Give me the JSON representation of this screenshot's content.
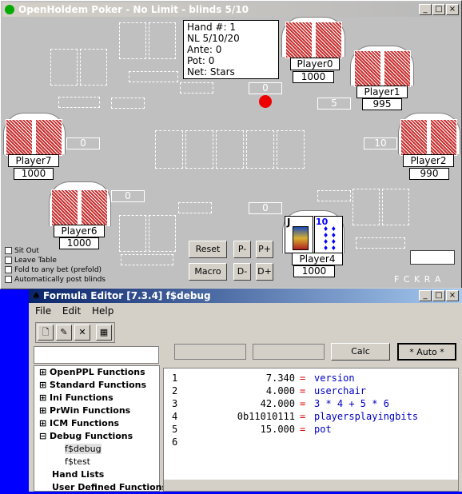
{
  "poker": {
    "title": "OpenHoldem Poker - No Limit - blinds 5/10",
    "info": [
      "Hand #: 1",
      "NL 5/10/20",
      "Ante: 0",
      "Pot: 0",
      "Net: Stars"
    ],
    "players": [
      {
        "name": "Player0",
        "balance": "1000"
      },
      {
        "name": "Player1",
        "balance": "995",
        "bet": "5"
      },
      {
        "name": "Player2",
        "balance": "990",
        "bet": "10"
      },
      {
        "name": "Player4",
        "balance": "1000",
        "bet": "0"
      },
      {
        "name": "Player6",
        "balance": "1000",
        "bet": "0"
      },
      {
        "name": "Player7",
        "balance": "1000",
        "bet": "0"
      }
    ],
    "p0bet": "0",
    "buttons": {
      "reset": "Reset",
      "pminus": "P-",
      "pplus": "P+",
      "macro": "Macro",
      "dminus": "D-",
      "dplus": "D+"
    },
    "checks": [
      "Sit Out",
      "Leave Table",
      "Fold to any bet (prefold)",
      "Automatically post blinds"
    ],
    "flags": "F C K R A",
    "hero_cards": [
      "J",
      "10"
    ]
  },
  "editor": {
    "title": "Formula Editor [7.3.4] f$debug",
    "menu": [
      "File",
      "Edit",
      "Help"
    ],
    "calc": "Calc",
    "auto": "* Auto *",
    "tree": [
      "OpenPPL Functions",
      "Standard Functions",
      "Ini Functions",
      "PrWin Functions",
      "ICM Functions",
      "Debug Functions",
      "f$debug",
      "f$test",
      "Hand Lists",
      "User Defined Functions"
    ],
    "lines": [
      {
        "n": "1",
        "v": "7.340",
        "e": "version"
      },
      {
        "n": "2",
        "v": "4.000",
        "e": "userchair"
      },
      {
        "n": "3",
        "v": "42.000",
        "e": "3 * 4 + 5 * 6"
      },
      {
        "n": "4",
        "v": "0b11010111",
        "e": "playersplayingbits"
      },
      {
        "n": "5",
        "v": "15.000",
        "e": "pot"
      },
      {
        "n": "6",
        "v": "",
        "e": ""
      }
    ]
  }
}
